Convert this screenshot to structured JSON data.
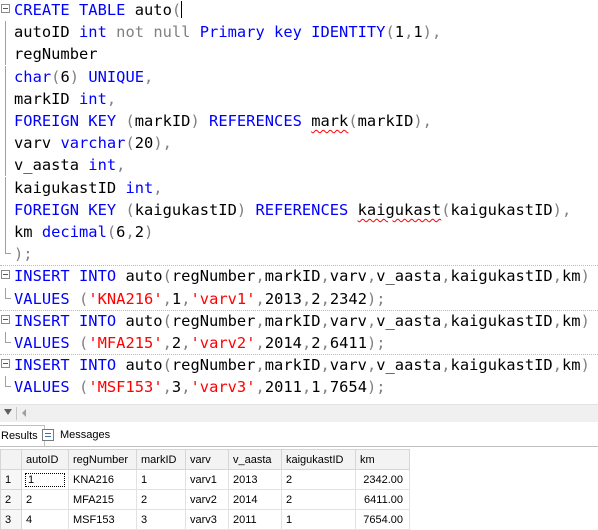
{
  "editor": {
    "lines": [
      [
        [
          "kw",
          "CREATE TABLE "
        ],
        [
          "tx",
          "auto"
        ],
        [
          "gr",
          "("
        ]
      ],
      [
        [
          "tx",
          "autoID "
        ],
        [
          "kw",
          "int "
        ],
        [
          "gr",
          "not null "
        ],
        [
          "kw",
          "Primary key IDENTITY"
        ],
        [
          "gr",
          "("
        ],
        [
          "tx",
          "1"
        ],
        [
          "gr",
          ","
        ],
        [
          "tx",
          "1"
        ],
        [
          "gr",
          "),"
        ]
      ],
      [
        [
          "tx",
          "regNumber"
        ]
      ],
      [
        [
          "kw",
          "char"
        ],
        [
          "gr",
          "("
        ],
        [
          "tx",
          "6"
        ],
        [
          "gr",
          ") "
        ],
        [
          "kw",
          "UNIQUE"
        ],
        [
          "gr",
          ","
        ]
      ],
      [
        [
          "tx",
          "markID "
        ],
        [
          "kw",
          "int"
        ],
        [
          "gr",
          ","
        ]
      ],
      [
        [
          "kw",
          "FOREIGN KEY "
        ],
        [
          "gr",
          "("
        ],
        [
          "tx",
          "markID"
        ],
        [
          "gr",
          ") "
        ],
        [
          "kw",
          "REFERENCES "
        ],
        [
          "sq",
          "mark"
        ],
        [
          "gr",
          "("
        ],
        [
          "tx",
          "markID"
        ],
        [
          "gr",
          "),"
        ]
      ],
      [
        [
          "tx",
          "varv "
        ],
        [
          "kw",
          "varchar"
        ],
        [
          "gr",
          "("
        ],
        [
          "tx",
          "20"
        ],
        [
          "gr",
          "),"
        ]
      ],
      [
        [
          "tx",
          "v_aasta "
        ],
        [
          "kw",
          "int"
        ],
        [
          "gr",
          ","
        ]
      ],
      [
        [
          "tx",
          "kaigukastID "
        ],
        [
          "kw",
          "int"
        ],
        [
          "gr",
          ","
        ]
      ],
      [
        [
          "kw",
          "FOREIGN KEY "
        ],
        [
          "gr",
          "("
        ],
        [
          "tx",
          "kaigukastID"
        ],
        [
          "gr",
          ") "
        ],
        [
          "kw",
          "REFERENCES "
        ],
        [
          "sq",
          "kaigukast"
        ],
        [
          "gr",
          "("
        ],
        [
          "tx",
          "kaigukastID"
        ],
        [
          "gr",
          "),"
        ]
      ],
      [
        [
          "tx",
          "km "
        ],
        [
          "kw",
          "decimal"
        ],
        [
          "gr",
          "("
        ],
        [
          "tx",
          "6"
        ],
        [
          "gr",
          ","
        ],
        [
          "tx",
          "2"
        ],
        [
          "gr",
          ")"
        ]
      ],
      [
        [
          "gr",
          ");"
        ]
      ],
      [
        [
          "kw",
          "INSERT INTO "
        ],
        [
          "tx",
          "auto"
        ],
        [
          "gr",
          "("
        ],
        [
          "tx",
          "regNumber"
        ],
        [
          "gr",
          ","
        ],
        [
          "tx",
          "markID"
        ],
        [
          "gr",
          ","
        ],
        [
          "tx",
          "varv"
        ],
        [
          "gr",
          ","
        ],
        [
          "tx",
          "v_aasta"
        ],
        [
          "gr",
          ","
        ],
        [
          "tx",
          "kaigukastID"
        ],
        [
          "gr",
          ","
        ],
        [
          "tx",
          "km"
        ],
        [
          "gr",
          ")"
        ]
      ],
      [
        [
          "kw",
          "VALUES "
        ],
        [
          "gr",
          "("
        ],
        [
          "str",
          "'KNA216'"
        ],
        [
          "gr",
          ","
        ],
        [
          "tx",
          "1"
        ],
        [
          "gr",
          ","
        ],
        [
          "str",
          "'varv1'"
        ],
        [
          "gr",
          ","
        ],
        [
          "tx",
          "2013"
        ],
        [
          "gr",
          ","
        ],
        [
          "tx",
          "2"
        ],
        [
          "gr",
          ","
        ],
        [
          "tx",
          "2342"
        ],
        [
          "gr",
          ");"
        ]
      ],
      [
        [
          "kw",
          "INSERT INTO "
        ],
        [
          "tx",
          "auto"
        ],
        [
          "gr",
          "("
        ],
        [
          "tx",
          "regNumber"
        ],
        [
          "gr",
          ","
        ],
        [
          "tx",
          "markID"
        ],
        [
          "gr",
          ","
        ],
        [
          "tx",
          "varv"
        ],
        [
          "gr",
          ","
        ],
        [
          "tx",
          "v_aasta"
        ],
        [
          "gr",
          ","
        ],
        [
          "tx",
          "kaigukastID"
        ],
        [
          "gr",
          ","
        ],
        [
          "tx",
          "km"
        ],
        [
          "gr",
          ")"
        ]
      ],
      [
        [
          "kw",
          "VALUES "
        ],
        [
          "gr",
          "("
        ],
        [
          "str",
          "'MFA215'"
        ],
        [
          "gr",
          ","
        ],
        [
          "tx",
          "2"
        ],
        [
          "gr",
          ","
        ],
        [
          "str",
          "'varv2'"
        ],
        [
          "gr",
          ","
        ],
        [
          "tx",
          "2014"
        ],
        [
          "gr",
          ","
        ],
        [
          "tx",
          "2"
        ],
        [
          "gr",
          ","
        ],
        [
          "tx",
          "6411"
        ],
        [
          "gr",
          ");"
        ]
      ],
      [
        [
          "kw",
          "INSERT INTO "
        ],
        [
          "tx",
          "auto"
        ],
        [
          "gr",
          "("
        ],
        [
          "tx",
          "regNumber"
        ],
        [
          "gr",
          ","
        ],
        [
          "tx",
          "markID"
        ],
        [
          "gr",
          ","
        ],
        [
          "tx",
          "varv"
        ],
        [
          "gr",
          ","
        ],
        [
          "tx",
          "v_aasta"
        ],
        [
          "gr",
          ","
        ],
        [
          "tx",
          "kaigukastID"
        ],
        [
          "gr",
          ","
        ],
        [
          "tx",
          "km"
        ],
        [
          "gr",
          ")"
        ]
      ],
      [
        [
          "kw",
          "VALUES "
        ],
        [
          "gr",
          "("
        ],
        [
          "str",
          "'MSF153'"
        ],
        [
          "gr",
          ","
        ],
        [
          "tx",
          "3"
        ],
        [
          "gr",
          ","
        ],
        [
          "str",
          "'varv3'"
        ],
        [
          "gr",
          ","
        ],
        [
          "tx",
          "2011"
        ],
        [
          "gr",
          ","
        ],
        [
          "tx",
          "1"
        ],
        [
          "gr",
          ","
        ],
        [
          "tx",
          "7654"
        ],
        [
          "gr",
          ");"
        ]
      ]
    ]
  },
  "results_panel": {
    "tab_results": "Results",
    "tab_messages": "Messages",
    "columns": [
      "autoID",
      "regNumber",
      "markID",
      "varv",
      "v_aasta",
      "kaigukastID",
      "km"
    ],
    "rows": [
      {
        "rownum": "1",
        "cells": [
          "1",
          "KNA216",
          "1",
          "varv1",
          "2013",
          "2",
          "2342.00"
        ]
      },
      {
        "rownum": "2",
        "cells": [
          "2",
          "MFA215",
          "2",
          "varv2",
          "2014",
          "2",
          "6411.00"
        ]
      },
      {
        "rownum": "3",
        "cells": [
          "4",
          "MSF153",
          "3",
          "varv3",
          "2011",
          "1",
          "7654.00"
        ]
      }
    ]
  },
  "colors": {
    "keyword": "#0000ff",
    "operator": "#808080",
    "string": "#ff0000",
    "text": "#000000"
  }
}
